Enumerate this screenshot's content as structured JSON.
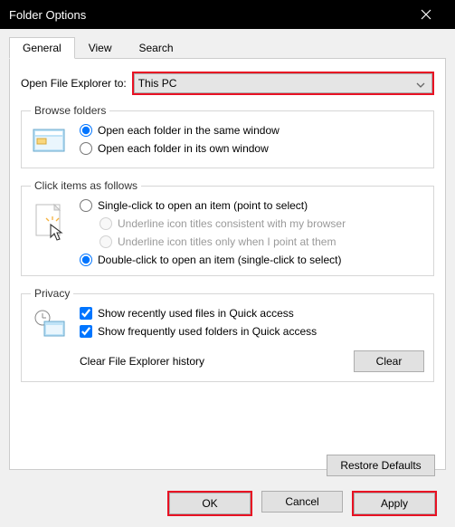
{
  "window": {
    "title": "Folder Options"
  },
  "tabs": {
    "general": "General",
    "view": "View",
    "search": "Search"
  },
  "open_to": {
    "label": "Open File Explorer to:",
    "selected": "This PC"
  },
  "browse": {
    "legend": "Browse folders",
    "same_window": "Open each folder in the same window",
    "own_window": "Open each folder in its own window"
  },
  "click": {
    "legend": "Click items as follows",
    "single": "Single-click to open an item (point to select)",
    "underline_browser": "Underline icon titles consistent with my browser",
    "underline_point": "Underline icon titles only when I point at them",
    "double": "Double-click to open an item (single-click to select)"
  },
  "privacy": {
    "legend": "Privacy",
    "recent_files": "Show recently used files in Quick access",
    "frequent_folders": "Show frequently used folders in Quick access",
    "clear_label": "Clear File Explorer history",
    "clear_btn": "Clear"
  },
  "restore": "Restore Defaults",
  "buttons": {
    "ok": "OK",
    "cancel": "Cancel",
    "apply": "Apply"
  }
}
